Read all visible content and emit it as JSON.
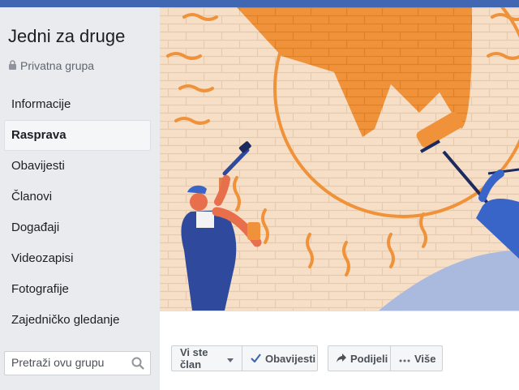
{
  "group": {
    "name": "Jedni za druge",
    "privacy": "Privatna grupa",
    "privacy_icon": "lock-icon"
  },
  "sidebar": {
    "items": [
      {
        "label": "Informacije",
        "active": false
      },
      {
        "label": "Rasprava",
        "active": true
      },
      {
        "label": "Obavijesti",
        "active": false
      },
      {
        "label": "Članovi",
        "active": false
      },
      {
        "label": "Događaji",
        "active": false
      },
      {
        "label": "Videozapisi",
        "active": false
      },
      {
        "label": "Fotografije",
        "active": false
      },
      {
        "label": "Zajedničko gledanje",
        "active": false
      }
    ],
    "search": {
      "placeholder": "Pretraži ovu grupu",
      "icon": "search-icon"
    }
  },
  "actions": {
    "member_label": "Vi ste član",
    "notifications_label": "Obavijesti",
    "share_label": "Podijeli",
    "more_label": "Više"
  },
  "colors": {
    "brand": "#4267b2",
    "cover_wall": "#f6dfc6",
    "sun": "#f0923a",
    "worker_blue": "#2f4a9c"
  }
}
